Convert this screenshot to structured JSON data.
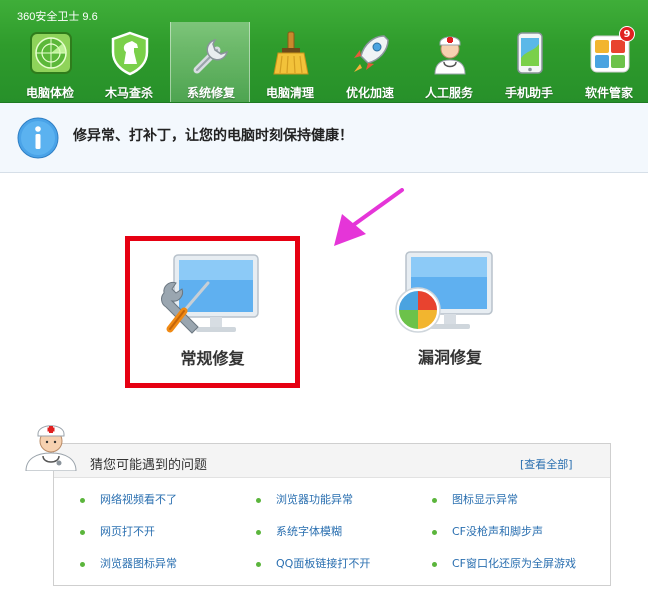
{
  "app": {
    "title": "360安全卫士 9.6"
  },
  "nav": {
    "items": [
      {
        "label": "电脑体检",
        "icon": "radar-icon"
      },
      {
        "label": "木马查杀",
        "icon": "horse-shield-icon"
      },
      {
        "label": "系统修复",
        "icon": "wrench-icon",
        "active": true
      },
      {
        "label": "电脑清理",
        "icon": "broom-icon"
      },
      {
        "label": "优化加速",
        "icon": "rocket-icon"
      },
      {
        "label": "人工服务",
        "icon": "doctor-icon"
      },
      {
        "label": "手机助手",
        "icon": "phone-icon"
      },
      {
        "label": "软件管家",
        "icon": "software-grid-icon",
        "badge": "9"
      }
    ]
  },
  "info": {
    "text": "修异常、打补丁，让您的电脑时刻保持健康！"
  },
  "cards": {
    "regular": {
      "label": "常规修复",
      "icon": "monitor-tools-icon"
    },
    "vulnerability": {
      "label": "漏洞修复",
      "icon": "monitor-windows-icon"
    }
  },
  "problems": {
    "title": "猜您可能遇到的问题",
    "view_all": "[查看全部]",
    "items": [
      "网络视频看不了",
      "浏览器功能异常",
      "图标显示异常",
      "网页打不开",
      "系统字体模糊",
      "CF没枪声和脚步声",
      "浏览器图标异常",
      "QQ面板链接打不开",
      "CF窗口化还原为全屏游戏"
    ]
  },
  "colors": {
    "toolbar_green": "#2f9c2c",
    "highlight_red": "#e60012",
    "arrow_pink": "#e535d8",
    "link_blue": "#2a6fb0",
    "bullet_green": "#5bb53c"
  }
}
